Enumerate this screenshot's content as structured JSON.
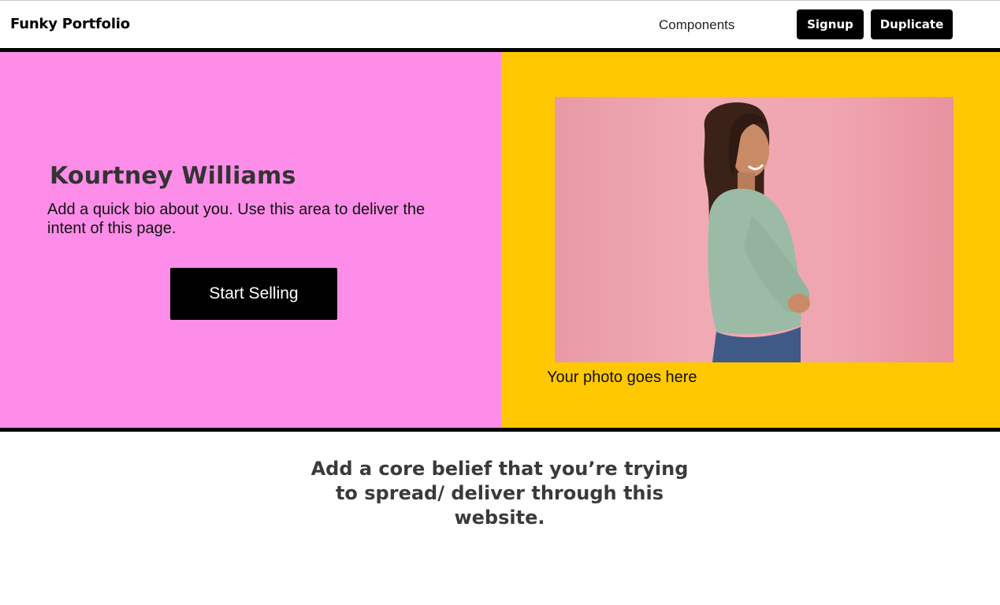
{
  "header": {
    "brand": "Funky Portfolio",
    "nav_components": "Components",
    "signup_label": "Signup",
    "duplicate_label": "Duplicate"
  },
  "hero": {
    "name": "Kourtney Williams",
    "bio": "Add a quick bio about you. Use this area to deliver the intent of this page.",
    "cta_label": "Start Selling",
    "photo_icon": "portrait-photo",
    "photo_caption": "Your photo goes here"
  },
  "belief": {
    "text": "Add a core belief that you’re trying to spread/ deliver through this website."
  },
  "colors": {
    "left_panel": "#fd8de9",
    "right_panel": "#ffc800",
    "button": "#000000",
    "button_text": "#ffffff"
  }
}
